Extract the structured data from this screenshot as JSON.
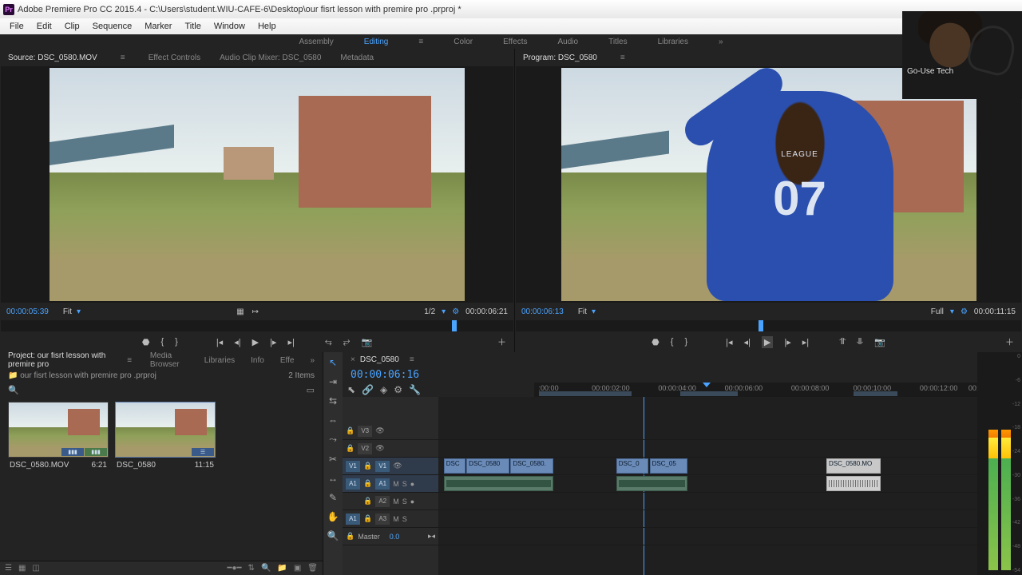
{
  "app": {
    "title": "Adobe Premiere Pro CC 2015.4 - C:\\Users\\student.WIU-CAFE-6\\Desktop\\our fisrt lesson with premire pro .prproj *"
  },
  "menu": [
    "File",
    "Edit",
    "Clip",
    "Sequence",
    "Marker",
    "Title",
    "Window",
    "Help"
  ],
  "workspaces": {
    "items": [
      "Assembly",
      "Editing",
      "Color",
      "Effects",
      "Audio",
      "Titles",
      "Libraries"
    ],
    "active": "Editing"
  },
  "source": {
    "tabs": [
      "Source: DSC_0580.MOV",
      "Effect Controls",
      "Audio Clip Mixer: DSC_0580",
      "Metadata"
    ],
    "current_tc": "00:00:05:39",
    "fit": "Fit",
    "res": "1/2",
    "duration": "00:00:06:21"
  },
  "program": {
    "tab": "Program: DSC_0580",
    "current_tc": "00:00:06:13",
    "fit": "Fit",
    "res": "Full",
    "duration": "00:00:11:15",
    "jersey_text": "LEAGUE",
    "jersey_num": "07"
  },
  "project": {
    "tabs": [
      "Project: our fisrt lesson with premire pro",
      "Media Browser",
      "Libraries",
      "Info",
      "Effe"
    ],
    "name": "our fisrt lesson with premire pro .prproj",
    "item_count": "2 Items",
    "bins": [
      {
        "name": "DSC_0580.MOV",
        "dur": "6:21",
        "type": "clip"
      },
      {
        "name": "DSC_0580",
        "dur": "11:15",
        "type": "seq"
      }
    ]
  },
  "timeline": {
    "tab": "DSC_0580",
    "playhead_tc": "00:00:06:16",
    "ruler": [
      ":00:00",
      "00:00:02:00",
      "00:00:04:00",
      "00:00:06:00",
      "00:00:08:00",
      "00:00:10:00",
      "00:00:12:00",
      "00:"
    ],
    "tracks": {
      "v3": "V3",
      "v2": "V2",
      "v1": "V1",
      "a1": "A1",
      "a2": "A2",
      "a3": "A3",
      "master": "Master",
      "master_val": "0.0"
    },
    "clips": {
      "g1a": "DSC",
      "g1b": "DSC_0580",
      "g1c": "DSC_0580.",
      "g2a": "DSC_0",
      "g2b": "DSC_05",
      "g3": "DSC_0580.MO"
    }
  },
  "meters": {
    "scale": [
      "0",
      "-6",
      "-12",
      "-18",
      "-24",
      "-30",
      "-36",
      "-42",
      "-48",
      "-54"
    ]
  },
  "webcam": {
    "name": "Go-Use Tech"
  }
}
